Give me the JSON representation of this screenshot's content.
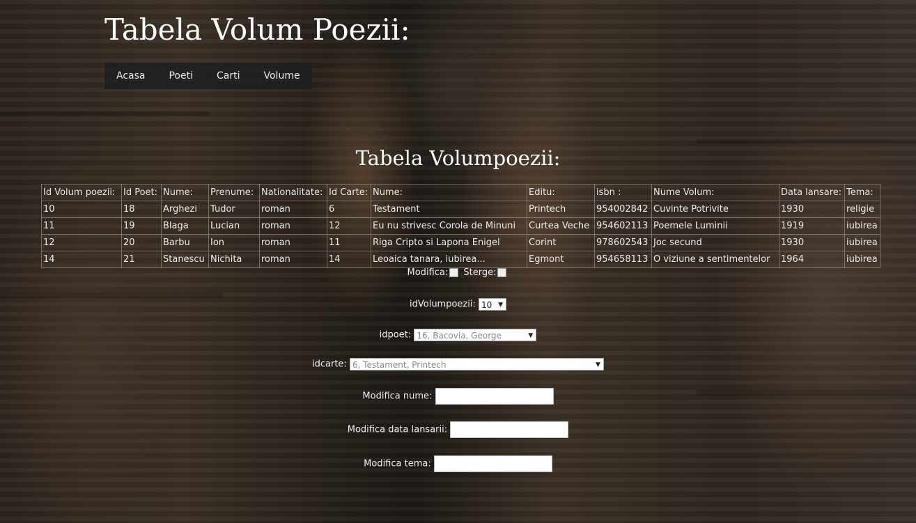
{
  "page": {
    "title": "Tabela Volum Poezii:"
  },
  "nav": {
    "items": [
      "Acasa",
      "Poeti",
      "Carti",
      "Volume"
    ]
  },
  "section": {
    "title": "Tabela Volumpoezii:"
  },
  "table": {
    "headers": [
      "Id Volum poezii:",
      "Id Poet:",
      "Nume:",
      "Prenume:",
      "Nationalitate:",
      "Id Carte:",
      "Nume:",
      "Editu:",
      "isbn :",
      "Nume Volum:",
      "Data lansare:",
      "Tema:"
    ],
    "rows": [
      [
        "10",
        "18",
        "Arghezi",
        "Tudor",
        "roman",
        "6",
        "Testament",
        "Printech",
        "954002842",
        "Cuvinte Potrivite",
        "1930",
        "religie"
      ],
      [
        "11",
        "19",
        "Blaga",
        "Lucian",
        "roman",
        "12",
        "Eu nu strivesc Corola de Minuni",
        "Curtea Veche",
        "954602113",
        "Poemele Luminii",
        "1919",
        "iubirea"
      ],
      [
        "12",
        "20",
        "Barbu",
        "Ion",
        "roman",
        "11",
        "Riga Cripto si Lapona Enigel",
        "Corint",
        "978602543",
        "Joc secund",
        "1930",
        "iubirea"
      ],
      [
        "14",
        "21",
        "Stanescu",
        "Nichita",
        "roman",
        "14",
        "Leoaica tanara, iubirea...",
        "Egmont",
        "954658113",
        "O viziune a sentimentelor",
        "1964",
        "iubirea"
      ]
    ]
  },
  "form": {
    "modifica_label": "Modifica:",
    "sterge_label": "Sterge:",
    "idvolum_label": "idVolumpoezii:",
    "idvolum_value": "10",
    "idpoet_label": "idpoet:",
    "idpoet_value": "16, Bacovia, George",
    "idcarte_label": "idcarte:",
    "idcarte_value": "6, Testament, Printech",
    "nume_label": "Modifica nume:",
    "data_label": "Modifica data lansarii:",
    "tema_label": "Modifica tema:"
  },
  "colors": {
    "nav_bg": "#1e1e20",
    "text": "#f2f2f2"
  }
}
